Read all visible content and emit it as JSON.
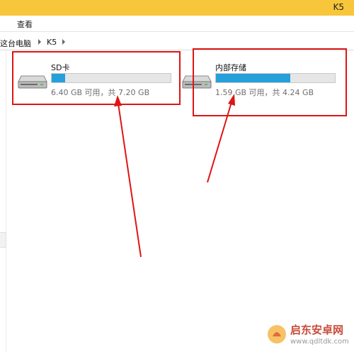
{
  "window": {
    "title": "K5"
  },
  "menu": {
    "items": [
      "查看"
    ]
  },
  "address": {
    "crumbs": [
      "这台电脑",
      "K5"
    ]
  },
  "drives": [
    {
      "name": "SD卡",
      "space_text": "6.40 GB 可用，共 7.20 GB",
      "used_fraction": 0.111
    },
    {
      "name": "内部存储",
      "space_text": "1.59 GB 可用，共 4.24 GB",
      "used_fraction": 0.625
    }
  ],
  "colors": {
    "titlebar": "#f8c63a",
    "bar_fill": "#26a0da",
    "annotation": "#e01414"
  },
  "watermark": {
    "text_cn": "启东安卓网",
    "url": "www.qdltdk.com"
  }
}
